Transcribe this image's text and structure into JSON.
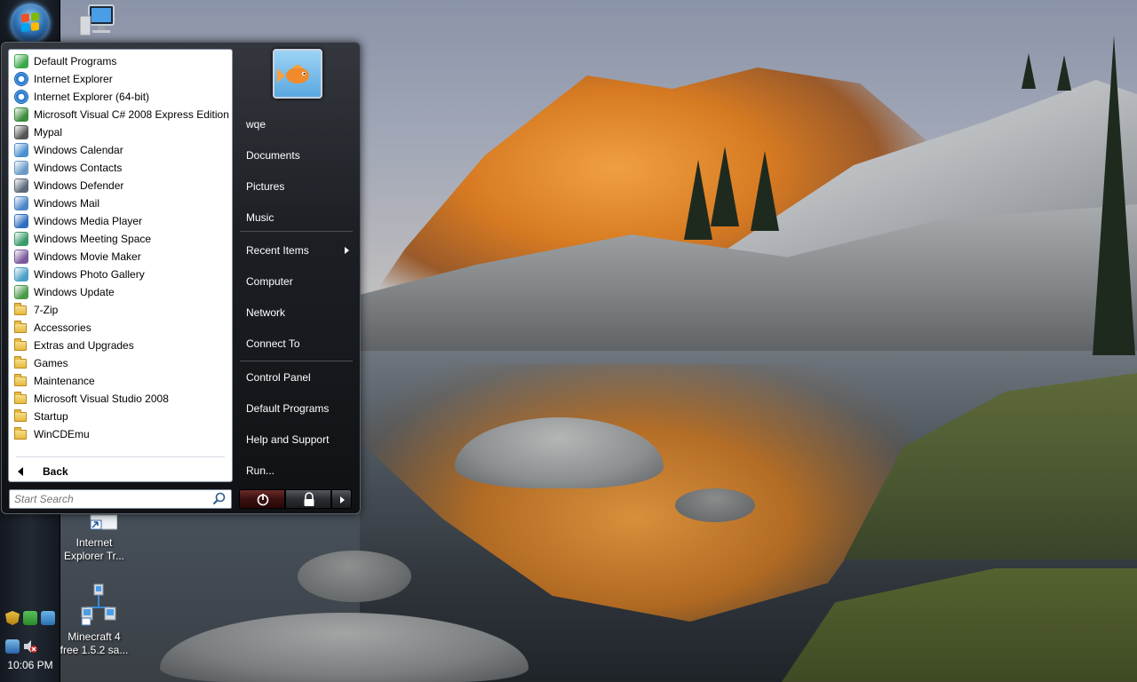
{
  "start_menu": {
    "programs": [
      {
        "label": "Default Programs",
        "icon": "default-programs-icon",
        "kind": "app",
        "color": "#3aa84a"
      },
      {
        "label": "Internet Explorer",
        "icon": "internet-explorer-icon",
        "kind": "ie",
        "color": "#2e7fd4"
      },
      {
        "label": "Internet Explorer (64-bit)",
        "icon": "internet-explorer-icon",
        "kind": "ie",
        "color": "#2e7fd4"
      },
      {
        "label": "Microsoft Visual C# 2008 Express Edition",
        "icon": "visual-csharp-icon",
        "kind": "app",
        "color": "#3c8d3c"
      },
      {
        "label": "Mypal",
        "icon": "mypal-icon",
        "kind": "app",
        "color": "#555555"
      },
      {
        "label": "Windows Calendar",
        "icon": "calendar-icon",
        "kind": "app",
        "color": "#4a8fd0"
      },
      {
        "label": "Windows Contacts",
        "icon": "contacts-icon",
        "kind": "app",
        "color": "#6a9ac8"
      },
      {
        "label": "Windows Defender",
        "icon": "defender-icon",
        "kind": "app",
        "color": "#5a6a7a"
      },
      {
        "label": "Windows Mail",
        "icon": "mail-icon",
        "kind": "app",
        "color": "#4b86c8"
      },
      {
        "label": "Windows Media Player",
        "icon": "media-player-icon",
        "kind": "app",
        "color": "#2f6fbf"
      },
      {
        "label": "Windows Meeting Space",
        "icon": "meeting-space-icon",
        "kind": "app",
        "color": "#3a9a6a"
      },
      {
        "label": "Windows Movie Maker",
        "icon": "movie-maker-icon",
        "kind": "app",
        "color": "#7a5a9a"
      },
      {
        "label": "Windows Photo Gallery",
        "icon": "photo-gallery-icon",
        "kind": "app",
        "color": "#4aa0c8"
      },
      {
        "label": "Windows Update",
        "icon": "windows-update-icon",
        "kind": "app",
        "color": "#4a9a4a"
      },
      {
        "label": "7-Zip",
        "icon": "folder-icon",
        "kind": "folder"
      },
      {
        "label": "Accessories",
        "icon": "folder-icon",
        "kind": "folder"
      },
      {
        "label": "Extras and Upgrades",
        "icon": "folder-icon",
        "kind": "folder"
      },
      {
        "label": "Games",
        "icon": "folder-icon",
        "kind": "folder"
      },
      {
        "label": "Maintenance",
        "icon": "folder-icon",
        "kind": "folder"
      },
      {
        "label": "Microsoft Visual Studio 2008",
        "icon": "folder-icon",
        "kind": "folder"
      },
      {
        "label": "Startup",
        "icon": "folder-icon",
        "kind": "folder"
      },
      {
        "label": "WinCDEmu",
        "icon": "folder-icon",
        "kind": "folder"
      }
    ],
    "back_label": "Back",
    "search_placeholder": "Start Search",
    "right_items": {
      "user": "wqe",
      "documents": "Documents",
      "pictures": "Pictures",
      "music": "Music",
      "recent_items": "Recent Items",
      "computer": "Computer",
      "network": "Network",
      "connect_to": "Connect To",
      "control_panel": "Control Panel",
      "default_programs": "Default Programs",
      "help_and_support": "Help and Support",
      "run": "Run..."
    }
  },
  "desktop_icons": {
    "ie_troubleshooter": "Internet Explorer Tr...",
    "minecraft": "Minecraft 4 free 1.5.2 sa..."
  },
  "taskbar": {
    "clock": "10:06 PM"
  },
  "colors": {
    "accent": "#2f74b8",
    "menu_dark": "#1c1f24",
    "power_red": "#6c2a2a"
  }
}
